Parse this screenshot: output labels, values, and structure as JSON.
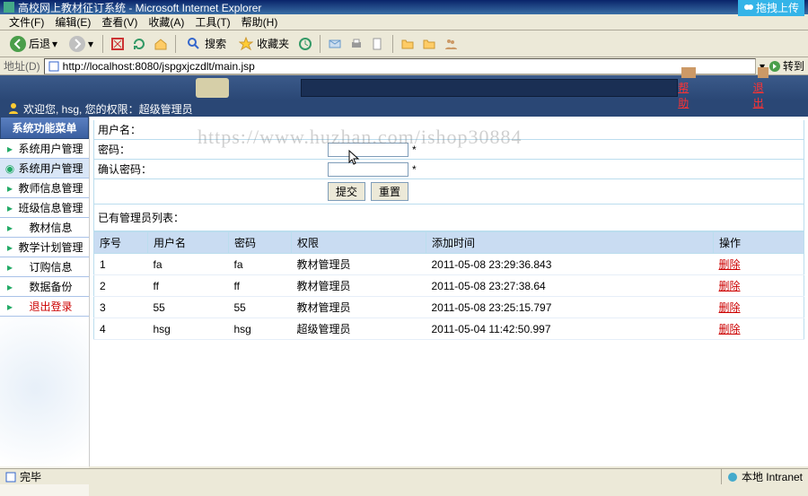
{
  "titlebar": {
    "title": "高校网上教材征订系统 - Microsoft Internet Explorer",
    "upload": "拖拽上传"
  },
  "menubar": [
    "文件(F)",
    "编辑(E)",
    "查看(V)",
    "收藏(A)",
    "工具(T)",
    "帮助(H)"
  ],
  "toolbar": {
    "back": "后退",
    "search": "搜索",
    "fav": "收藏夹"
  },
  "addrbar": {
    "label": "地址(D)",
    "url": "http://localhost:8080/jspgxjczdlt/main.jsp",
    "go": "转到"
  },
  "appband": {
    "help": "帮 助",
    "exit": "退 出"
  },
  "welcome": "欢迎您, hsg, 您的权限：超级管理员",
  "watermark": "https://www.huzhan.com/ishop30884",
  "sidebar": {
    "head": "系统功能菜单",
    "items": [
      {
        "label": "系统用户管理",
        "active": false
      },
      {
        "label": "系统用户管理",
        "active": true
      },
      {
        "label": "教师信息管理",
        "active": false
      },
      {
        "label": "班级信息管理",
        "active": false
      },
      {
        "label": "教材信息",
        "active": false
      },
      {
        "label": "教学计划管理",
        "active": false
      },
      {
        "label": "订购信息",
        "active": false
      },
      {
        "label": "数据备份",
        "active": false
      }
    ],
    "logout": "退出登录"
  },
  "form": {
    "username_label": "用户名：",
    "password_label": "密码：",
    "confirm_label": "确认密码：",
    "star": "*",
    "submit": "提交",
    "reset": "重置"
  },
  "list_label": "已有管理员列表：",
  "table": {
    "headers": [
      "序号",
      "用户名",
      "密码",
      "权限",
      "添加时间",
      "操作"
    ],
    "op_label": "删除",
    "rows": [
      {
        "no": "1",
        "user": "fa",
        "pwd": "fa",
        "role": "教材管理员",
        "time": "2011-05-08 23:29:36.843"
      },
      {
        "no": "2",
        "user": "ff",
        "pwd": "ff",
        "role": "教材管理员",
        "time": "2011-05-08 23:27:38.64"
      },
      {
        "no": "3",
        "user": "55",
        "pwd": "55",
        "role": "教材管理员",
        "time": "2011-05-08 23:25:15.797"
      },
      {
        "no": "4",
        "user": "hsg",
        "pwd": "hsg",
        "role": "超级管理员",
        "time": "2011-05-04 11:42:50.997"
      }
    ]
  },
  "statusbar": {
    "done": "完毕",
    "zone": "本地 Intranet"
  }
}
